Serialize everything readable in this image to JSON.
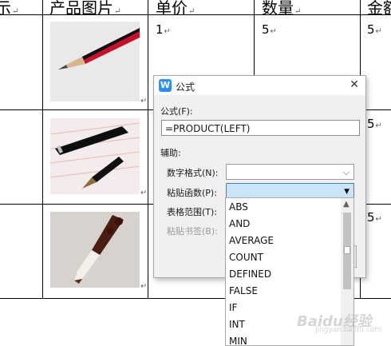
{
  "table": {
    "headers": [
      "示",
      "产品图片",
      "单价",
      "数量",
      "金额"
    ],
    "return_mark": "↵",
    "rows": [
      {
        "price": "1",
        "qty": "5",
        "amount": "5"
      },
      {
        "amount": "5"
      },
      {
        "amount": "5"
      }
    ]
  },
  "dialog": {
    "title": "公式",
    "app_icon": "W",
    "formula_label": "公式(F):",
    "formula_value": "=PRODUCT(LEFT)",
    "assist_label": "辅助:",
    "number_format_label": "数字格式(N):",
    "paste_function_label": "粘贴函数(P):",
    "table_range_label": "表格范围(T):",
    "paste_bookmark_label": "粘贴书签(B):"
  },
  "dropdown": {
    "items": [
      "ABS",
      "AND",
      "AVERAGE",
      "COUNT",
      "DEFINED",
      "FALSE",
      "IF",
      "INT",
      "MIN"
    ]
  },
  "icons": {
    "close": "close-icon",
    "chevron": "chevron-down-icon",
    "scroll_up": "scroll-up-icon"
  },
  "watermark": {
    "text": "Baidu经验",
    "sub": "jingyan.baidu.com"
  }
}
